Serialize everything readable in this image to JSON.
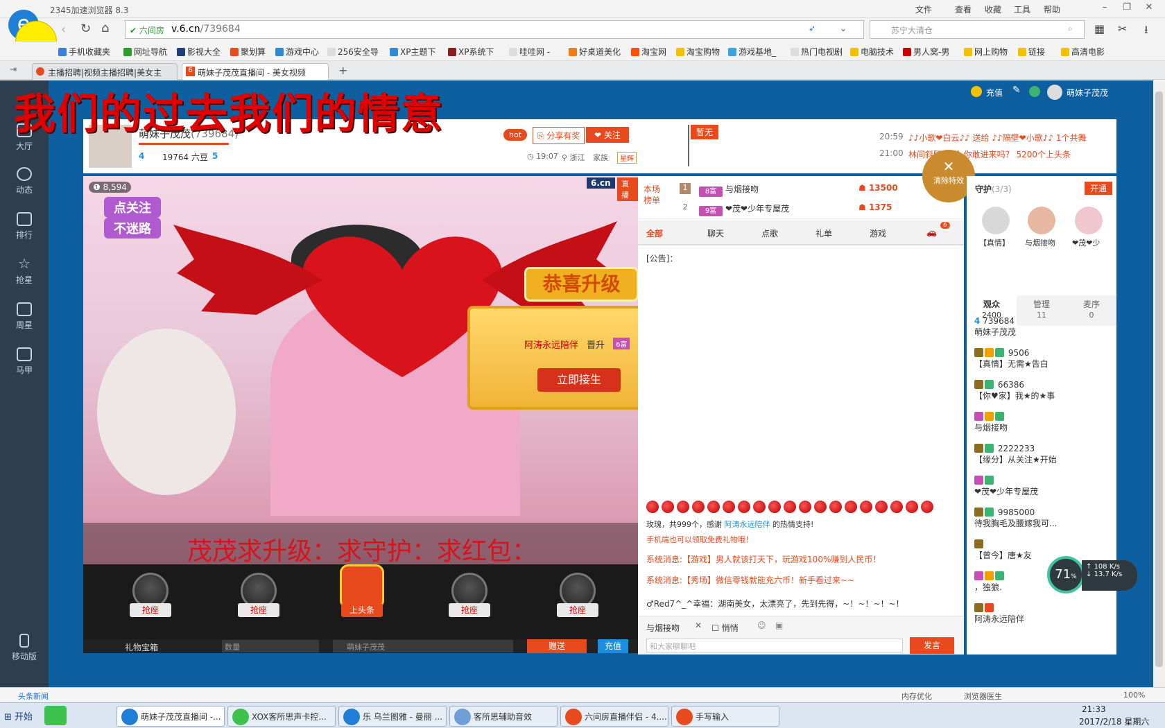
{
  "browser": {
    "title": "2345加速浏览器 8.3",
    "menus": [
      "文件",
      "查看",
      "收藏",
      "工具",
      "帮助"
    ],
    "site_badge": "六间房",
    "url_domain": "v.6.cn",
    "url_path": "/739684",
    "search_placeholder": "苏宁大清仓",
    "bookmarks": [
      "手机收藏夹",
      "网址导航",
      "影视大全",
      "聚划算",
      "游戏中心",
      "256安全导",
      "XP主题下",
      "XP系统下",
      "哇哇网 -",
      "好桌道美化",
      "淘宝网",
      "淘宝购物",
      "游戏基地_",
      "热门电视剧",
      "电脑技术",
      "男人窝-男",
      "网上购物",
      "链接",
      "高清电影"
    ],
    "tabs": [
      {
        "label": "主播招聘|视频主播招聘|美女主"
      },
      {
        "label": "萌妹子茂茂直播间 - 美女视频"
      }
    ],
    "colors": {
      "accent": "#e8491d",
      "sidebar": "#2c3e50",
      "page_bg": "#0e5f9f"
    }
  },
  "overlay_text": "我们的过去我们的情意",
  "sidebar": {
    "items": [
      "大厅",
      "动态",
      "排行",
      "抢星",
      "周星",
      "马甲"
    ],
    "bottom": "移动版"
  },
  "topbar": {
    "recharge": "充值",
    "user": "萌妹子茂茂"
  },
  "anchor": {
    "name": "萌妹子茂茂",
    "room_id": "(739684)",
    "level": "4",
    "beans": "19764 六豆",
    "level2": "5",
    "time": "19:07",
    "location": "浙江",
    "family_label": "家族",
    "family_tag": "星辉",
    "hot": "hot",
    "share": "分享有奖",
    "follow": "关注",
    "flag": "暂无"
  },
  "ticker": [
    {
      "time": "20:59",
      "text": "♪♪小歌❤白云♪♪ 送给 ♪♪隔壁❤小歌♪♪ 1个共舞"
    },
    {
      "time": "21:00",
      "text": "林间斜阳 送给 你敢进来吗？ 5200个上头条"
    }
  ],
  "video": {
    "fans": "8,594",
    "logo": "6.cn",
    "live": "直播",
    "follow_btn": "点关注",
    "follow_btn2": "不迷路",
    "marquee": "茂茂求升级：求守护：求红包："
  },
  "rank": {
    "label1": "本场",
    "label2": "榜单",
    "rows": [
      {
        "n": "1",
        "lvl": "8富",
        "name": "与烟接吻",
        "score": "13500"
      },
      {
        "n": "2",
        "lvl": "9富",
        "name": "❤茂❤少年专屋茂",
        "score": "1375"
      }
    ]
  },
  "clear_effects": "清除特效",
  "chat": {
    "tabs": [
      "全部",
      "聊天",
      "点歌",
      "礼单",
      "游戏"
    ],
    "car_count": "6",
    "notice": "[公告]：",
    "rose_msg": "玫瑰，共999个，感谢",
    "rose_user": "阿涛永远陪伴",
    "rose_tail": "的热情支持!",
    "sys1": "系统消息:【游戏】男人就该打天下，玩游戏100%赚到人民币！",
    "sys2": "系统消息:【秀场】微信零钱就能充六币！新手看过来~~",
    "sys0": "手机端也可以领取免费礼物哦！",
    "last": "♂Red7^_^幸福：湖南美女，太漂亮了，先到先得，~！~！~！~！",
    "target": "与烟接吻",
    "whisper": "悄悄",
    "input_placeholder": "和大家聊聊吧",
    "send": "发言"
  },
  "levelup": {
    "title": "恭喜升级",
    "user": "阿涛永远陪伴",
    "action": "晋升",
    "lvl": "6富",
    "btn": "立即接生"
  },
  "seats": [
    "抢座",
    "抢座",
    "上头条",
    "抢座",
    "抢座"
  ],
  "gift_bar": {
    "label": "礼物宝箱",
    "qty_label": "数量",
    "target": "萌妹子茂茂",
    "give": "赠送",
    "recharge": "充值"
  },
  "guard": {
    "title": "守护",
    "count": "(3/3)",
    "open": "开通",
    "names": [
      "【真情】",
      "与烟接吻",
      "❤茂❤少"
    ]
  },
  "audience": {
    "tabs": [
      {
        "label": "观众",
        "n": "2400"
      },
      {
        "label": "管理",
        "n": "11"
      },
      {
        "label": "麦序",
        "n": "0"
      }
    ],
    "rows": [
      {
        "lvl": "4",
        "num": "739684",
        "name": "萌妹子茂茂"
      },
      {
        "lvl": "",
        "num": "9506",
        "name": "【真情】无需★告白"
      },
      {
        "lvl": "",
        "num": "66386",
        "name": "【你♥家】我★的★事"
      },
      {
        "lvl": "",
        "num": "",
        "name": "与烟接吻"
      },
      {
        "lvl": "",
        "num": "2222233",
        "name": "【缘分】从关注★开始"
      },
      {
        "lvl": "",
        "num": "",
        "name": "❤茂❤少年专屋茂"
      },
      {
        "lvl": "",
        "num": "9985000",
        "name": "待我胸毛及腰嫁我可..."
      },
      {
        "lvl": "",
        "num": "",
        "name": "【曾今】唐★友"
      },
      {
        "lvl": "",
        "num": "",
        "name": "，独狼."
      },
      {
        "lvl": "",
        "num": "",
        "name": "阿涛永远陪伴"
      }
    ]
  },
  "speed": {
    "pct": "71",
    "up": "108",
    "down": "13.7",
    "unit": "K/s"
  },
  "statusbar": {
    "news": "头条新闻",
    "mem": "内存优化",
    "doctor": "浏览器医生",
    "zoom": "100%"
  },
  "taskbar": {
    "start": "开始",
    "items": [
      "萌妹子茂茂直播间 -...",
      "XOX客所思声卡控...",
      "乐 乌兰图雅 - 曼丽 ...",
      "客所思辅助音效",
      "六间房直播伴侣 - 4....",
      "手写输入"
    ],
    "time": "21:33",
    "date": "2017/2/18 星期六"
  }
}
